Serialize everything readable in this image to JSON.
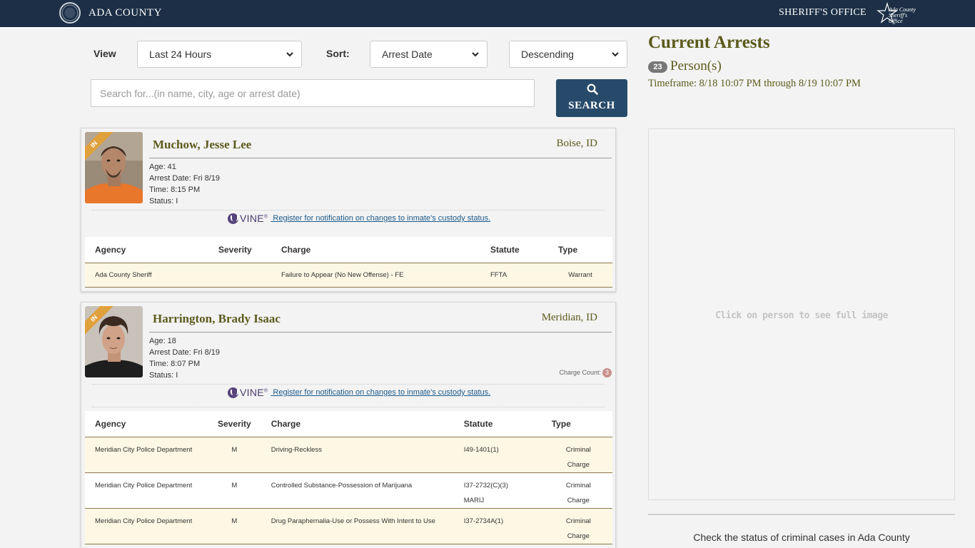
{
  "header": {
    "brand": "ADA COUNTY",
    "office": "SHERIFF'S OFFICE",
    "office_logo_line1": "Ada County",
    "office_logo_line2": "Sheriff's Office"
  },
  "controls": {
    "view_label": "View",
    "view_value": "Last 24 Hours",
    "sort_label": "Sort:",
    "sort_value": "Arrest Date",
    "order_value": "Descending",
    "search_placeholder": "Search for...(in name, city, age or arrest date)",
    "search_button": "SEARCH"
  },
  "table_headers": {
    "agency": "Agency",
    "severity": "Severity",
    "charge": "Charge",
    "statute": "Statute",
    "type": "Type"
  },
  "vine": {
    "word": "VINE",
    "tm": "®",
    "link": " Register for notification on changes to inmate's custody status."
  },
  "persons": [
    {
      "badge": "IN",
      "name": "Muchow, Jesse Lee",
      "city": "Boise, ID",
      "age": "Age: 41",
      "arrest_date": "Arrest Date: Fri 8/19",
      "time": "Time: 8:15 PM",
      "status": "Status: I",
      "charges": [
        {
          "agency": "Ada County Sheriff",
          "severity": "",
          "charge": "Failure to Appear (No New Offense) - FE",
          "statute": "FFTA",
          "type": "Warrant"
        }
      ]
    },
    {
      "badge": "IN",
      "name": "Harrington, Brady Isaac",
      "city": "Meridian, ID",
      "age": "Age: 18",
      "arrest_date": "Arrest Date: Fri 8/19",
      "time": "Time: 8:07 PM",
      "status": "Status: I",
      "charge_count_label": "Charge Count:",
      "charge_count": "3",
      "charges": [
        {
          "agency": "Meridian City Police Department",
          "severity": "M",
          "charge": "Driving-Reckless",
          "statute": "I49-1401(1)",
          "type": "Criminal Charge"
        },
        {
          "agency": "Meridian City Police Department",
          "severity": "M",
          "charge": "Controlled Substance-Possession of Marijuana",
          "statute": "I37-2732(C)(3)MARIJ",
          "type": "Criminal Charge"
        },
        {
          "agency": "Meridian City Police Department",
          "severity": "M",
          "charge": "Drug Paraphernalia-Use or Possess With Intent to Use",
          "statute": "I37-2734A(1)",
          "type": "Criminal Charge"
        }
      ]
    }
  ],
  "summary": {
    "title": "Current Arrests",
    "count": "23",
    "persons_label": "Person(s)",
    "timeframe": "Timeframe: 8/18 10:07 PM through 8/19 10:07 PM"
  },
  "preview": {
    "hint": "Click on person to see full image"
  },
  "footer_link": "Check the status of criminal cases in Ada County",
  "colors": {
    "header_bg": "#1c2f46",
    "accent_olive": "#5b5a1c",
    "search_button": "#284a6a",
    "badge_orange": "#e0a03c",
    "row_highlight": "#fdf7e4"
  }
}
